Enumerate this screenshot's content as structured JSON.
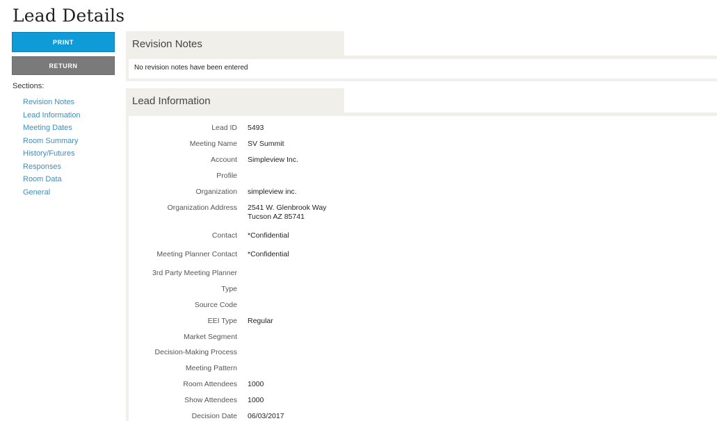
{
  "page": {
    "title": "Lead Details"
  },
  "actions": {
    "print_label": "PRINT",
    "return_label": "RETURN"
  },
  "sidebar": {
    "sections_label": "Sections:",
    "items": [
      {
        "label": "Revision Notes"
      },
      {
        "label": "Lead Information"
      },
      {
        "label": "Meeting Dates"
      },
      {
        "label": "Room Summary"
      },
      {
        "label": "History/Futures"
      },
      {
        "label": "Responses"
      },
      {
        "label": "Room Data"
      },
      {
        "label": "General"
      }
    ]
  },
  "revision_notes": {
    "title": "Revision Notes",
    "empty_text": "No revision notes have been entered"
  },
  "lead_information": {
    "title": "Lead Information",
    "fields": [
      {
        "label": "Lead ID",
        "value": "5493"
      },
      {
        "label": "Meeting Name",
        "value": "SV Summit"
      },
      {
        "label": "Account",
        "value": "Simpleview Inc."
      },
      {
        "label": "Profile",
        "value": ""
      },
      {
        "label": "Organization",
        "value": "simpleview inc."
      },
      {
        "label": "Organization Address",
        "value": "2541 W. Glenbrook Way",
        "value2": "Tucson AZ 85741"
      },
      {
        "label": "Contact",
        "value": "*Confidential"
      },
      {
        "label": "Meeting Planner Contact",
        "value": "*Confidential"
      },
      {
        "label": "3rd Party Meeting Planner",
        "value": ""
      },
      {
        "label": "Type",
        "value": ""
      },
      {
        "label": "Source Code",
        "value": ""
      },
      {
        "label": "EEI Type",
        "value": "Regular"
      },
      {
        "label": "Market Segment",
        "value": ""
      },
      {
        "label": "Decision-Making Process",
        "value": ""
      },
      {
        "label": "Meeting Pattern",
        "value": ""
      },
      {
        "label": "Room Attendees",
        "value": "1000"
      },
      {
        "label": "Show Attendees",
        "value": "1000"
      },
      {
        "label": "Decision Date",
        "value": "06/03/2017"
      }
    ]
  }
}
